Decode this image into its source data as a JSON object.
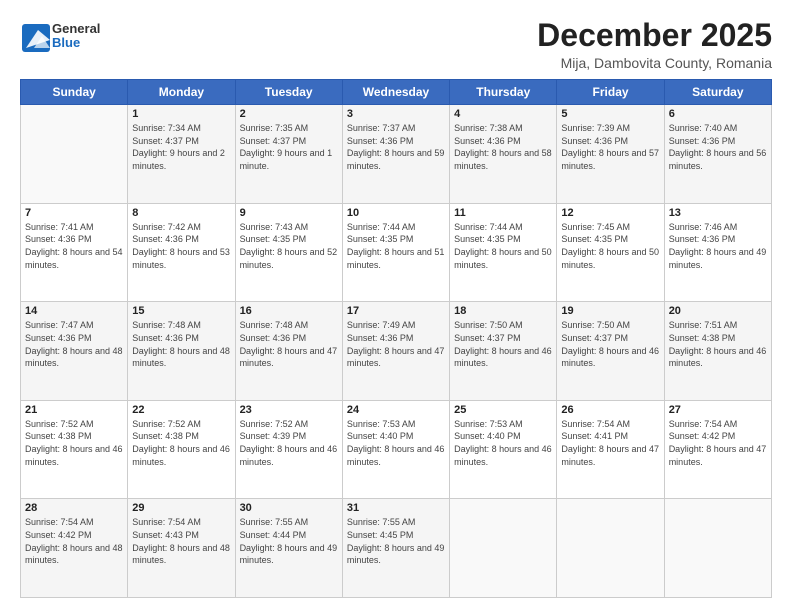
{
  "logo": {
    "general": "General",
    "blue": "Blue"
  },
  "title": "December 2025",
  "subtitle": "Mija, Dambovita County, Romania",
  "days_header": [
    "Sunday",
    "Monday",
    "Tuesday",
    "Wednesday",
    "Thursday",
    "Friday",
    "Saturday"
  ],
  "weeks": [
    [
      {
        "day": "",
        "sunrise": "",
        "sunset": "",
        "daylight": ""
      },
      {
        "day": "1",
        "sunrise": "Sunrise: 7:34 AM",
        "sunset": "Sunset: 4:37 PM",
        "daylight": "Daylight: 9 hours and 2 minutes."
      },
      {
        "day": "2",
        "sunrise": "Sunrise: 7:35 AM",
        "sunset": "Sunset: 4:37 PM",
        "daylight": "Daylight: 9 hours and 1 minute."
      },
      {
        "day": "3",
        "sunrise": "Sunrise: 7:37 AM",
        "sunset": "Sunset: 4:36 PM",
        "daylight": "Daylight: 8 hours and 59 minutes."
      },
      {
        "day": "4",
        "sunrise": "Sunrise: 7:38 AM",
        "sunset": "Sunset: 4:36 PM",
        "daylight": "Daylight: 8 hours and 58 minutes."
      },
      {
        "day": "5",
        "sunrise": "Sunrise: 7:39 AM",
        "sunset": "Sunset: 4:36 PM",
        "daylight": "Daylight: 8 hours and 57 minutes."
      },
      {
        "day": "6",
        "sunrise": "Sunrise: 7:40 AM",
        "sunset": "Sunset: 4:36 PM",
        "daylight": "Daylight: 8 hours and 56 minutes."
      }
    ],
    [
      {
        "day": "7",
        "sunrise": "Sunrise: 7:41 AM",
        "sunset": "Sunset: 4:36 PM",
        "daylight": "Daylight: 8 hours and 54 minutes."
      },
      {
        "day": "8",
        "sunrise": "Sunrise: 7:42 AM",
        "sunset": "Sunset: 4:36 PM",
        "daylight": "Daylight: 8 hours and 53 minutes."
      },
      {
        "day": "9",
        "sunrise": "Sunrise: 7:43 AM",
        "sunset": "Sunset: 4:35 PM",
        "daylight": "Daylight: 8 hours and 52 minutes."
      },
      {
        "day": "10",
        "sunrise": "Sunrise: 7:44 AM",
        "sunset": "Sunset: 4:35 PM",
        "daylight": "Daylight: 8 hours and 51 minutes."
      },
      {
        "day": "11",
        "sunrise": "Sunrise: 7:44 AM",
        "sunset": "Sunset: 4:35 PM",
        "daylight": "Daylight: 8 hours and 50 minutes."
      },
      {
        "day": "12",
        "sunrise": "Sunrise: 7:45 AM",
        "sunset": "Sunset: 4:35 PM",
        "daylight": "Daylight: 8 hours and 50 minutes."
      },
      {
        "day": "13",
        "sunrise": "Sunrise: 7:46 AM",
        "sunset": "Sunset: 4:36 PM",
        "daylight": "Daylight: 8 hours and 49 minutes."
      }
    ],
    [
      {
        "day": "14",
        "sunrise": "Sunrise: 7:47 AM",
        "sunset": "Sunset: 4:36 PM",
        "daylight": "Daylight: 8 hours and 48 minutes."
      },
      {
        "day": "15",
        "sunrise": "Sunrise: 7:48 AM",
        "sunset": "Sunset: 4:36 PM",
        "daylight": "Daylight: 8 hours and 48 minutes."
      },
      {
        "day": "16",
        "sunrise": "Sunrise: 7:48 AM",
        "sunset": "Sunset: 4:36 PM",
        "daylight": "Daylight: 8 hours and 47 minutes."
      },
      {
        "day": "17",
        "sunrise": "Sunrise: 7:49 AM",
        "sunset": "Sunset: 4:36 PM",
        "daylight": "Daylight: 8 hours and 47 minutes."
      },
      {
        "day": "18",
        "sunrise": "Sunrise: 7:50 AM",
        "sunset": "Sunset: 4:37 PM",
        "daylight": "Daylight: 8 hours and 46 minutes."
      },
      {
        "day": "19",
        "sunrise": "Sunrise: 7:50 AM",
        "sunset": "Sunset: 4:37 PM",
        "daylight": "Daylight: 8 hours and 46 minutes."
      },
      {
        "day": "20",
        "sunrise": "Sunrise: 7:51 AM",
        "sunset": "Sunset: 4:38 PM",
        "daylight": "Daylight: 8 hours and 46 minutes."
      }
    ],
    [
      {
        "day": "21",
        "sunrise": "Sunrise: 7:52 AM",
        "sunset": "Sunset: 4:38 PM",
        "daylight": "Daylight: 8 hours and 46 minutes."
      },
      {
        "day": "22",
        "sunrise": "Sunrise: 7:52 AM",
        "sunset": "Sunset: 4:38 PM",
        "daylight": "Daylight: 8 hours and 46 minutes."
      },
      {
        "day": "23",
        "sunrise": "Sunrise: 7:52 AM",
        "sunset": "Sunset: 4:39 PM",
        "daylight": "Daylight: 8 hours and 46 minutes."
      },
      {
        "day": "24",
        "sunrise": "Sunrise: 7:53 AM",
        "sunset": "Sunset: 4:40 PM",
        "daylight": "Daylight: 8 hours and 46 minutes."
      },
      {
        "day": "25",
        "sunrise": "Sunrise: 7:53 AM",
        "sunset": "Sunset: 4:40 PM",
        "daylight": "Daylight: 8 hours and 46 minutes."
      },
      {
        "day": "26",
        "sunrise": "Sunrise: 7:54 AM",
        "sunset": "Sunset: 4:41 PM",
        "daylight": "Daylight: 8 hours and 47 minutes."
      },
      {
        "day": "27",
        "sunrise": "Sunrise: 7:54 AM",
        "sunset": "Sunset: 4:42 PM",
        "daylight": "Daylight: 8 hours and 47 minutes."
      }
    ],
    [
      {
        "day": "28",
        "sunrise": "Sunrise: 7:54 AM",
        "sunset": "Sunset: 4:42 PM",
        "daylight": "Daylight: 8 hours and 48 minutes."
      },
      {
        "day": "29",
        "sunrise": "Sunrise: 7:54 AM",
        "sunset": "Sunset: 4:43 PM",
        "daylight": "Daylight: 8 hours and 48 minutes."
      },
      {
        "day": "30",
        "sunrise": "Sunrise: 7:55 AM",
        "sunset": "Sunset: 4:44 PM",
        "daylight": "Daylight: 8 hours and 49 minutes."
      },
      {
        "day": "31",
        "sunrise": "Sunrise: 7:55 AM",
        "sunset": "Sunset: 4:45 PM",
        "daylight": "Daylight: 8 hours and 49 minutes."
      },
      {
        "day": "",
        "sunrise": "",
        "sunset": "",
        "daylight": ""
      },
      {
        "day": "",
        "sunrise": "",
        "sunset": "",
        "daylight": ""
      },
      {
        "day": "",
        "sunrise": "",
        "sunset": "",
        "daylight": ""
      }
    ]
  ]
}
